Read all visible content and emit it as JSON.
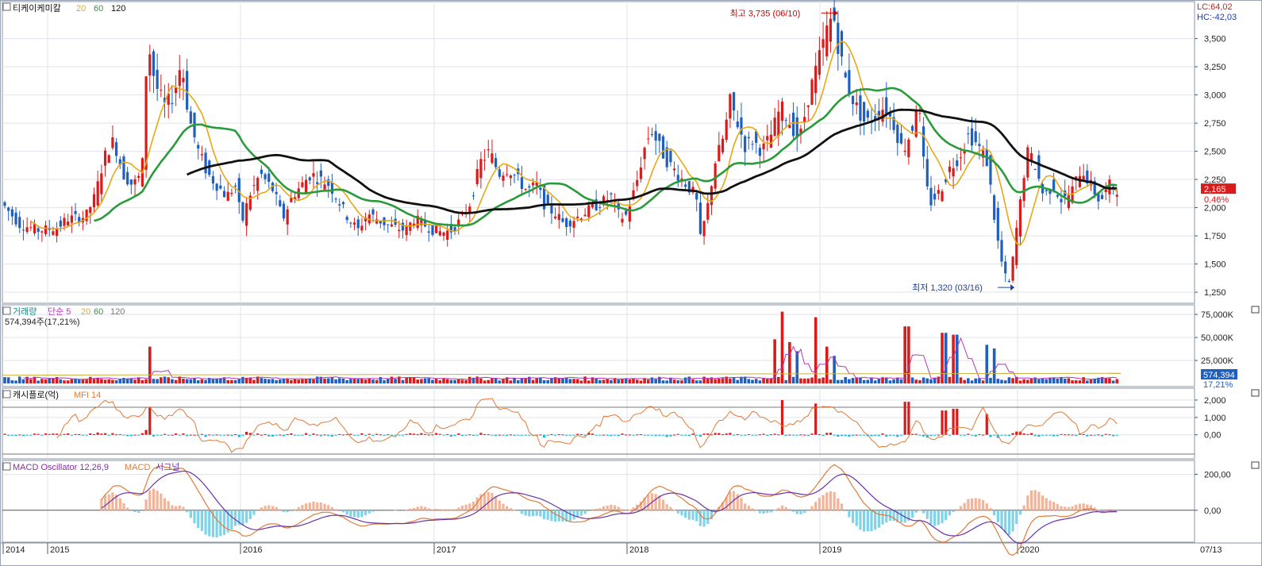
{
  "stock_name": "티케이케미칼",
  "price_ma_periods": [
    "20",
    "60",
    "120"
  ],
  "colors": {
    "up": "#d81b1b",
    "down": "#1f5fbf",
    "ma20": "#e6a817",
    "ma60": "#2b9a3a",
    "ma120": "#111111",
    "grid": "#dfe3ea",
    "mfi": "#e07b39",
    "macd": "#e07b39",
    "signal": "#6a33a8",
    "osc_pos": "#f4b397",
    "osc_neg": "#7fd3e8",
    "cash_pos": "#d81b1b",
    "cash_neg": "#22b6d8"
  },
  "top_right": {
    "lc": "LC:64,02",
    "hc": "HC:-42,03"
  },
  "price_high_label": "최고 3,735 (06/10)",
  "price_low_label": "최저 1,320 (03/16)",
  "last_price_tag": "2,165",
  "last_change_tag": "0.46%",
  "volume_title": {
    "name": "거래량",
    "ma_type": "단순 5",
    "p20": "20",
    "p60": "60",
    "p120": "120"
  },
  "volume_info": "574,394주(17,21%)",
  "volume_tag": "574,394",
  "volume_pct_tag": "17,21%",
  "cash_title": {
    "name": "캐시플로(억)",
    "mfi": "MFI 14"
  },
  "macd_title": {
    "name": "MACD Oscillator 12,26,9",
    "macd": "MACD",
    "signal": "시그널"
  },
  "end_date_label": "07/13",
  "chart_data": [
    {
      "type": "candlestick",
      "title": "티케이케미칼",
      "x_labels": [
        "2014",
        "2015",
        "2016",
        "2017",
        "2018",
        "2019",
        "2020"
      ],
      "y_ticks": [
        1250,
        1500,
        1750,
        2000,
        2250,
        2500,
        2750,
        3000,
        3250,
        3500
      ],
      "y_tick_labels": [
        "1,250",
        "1,500",
        "1,750",
        "2,000",
        "2,250",
        "2,500",
        "2,750",
        "3,000",
        "3,250",
        "3,500"
      ],
      "ylim": [
        1180,
        3800
      ],
      "close_path": [
        {
          "t": 2014.0,
          "v": 2050
        },
        {
          "t": 2014.1,
          "v": 1850
        },
        {
          "t": 2014.2,
          "v": 1800
        },
        {
          "t": 2014.3,
          "v": 1820
        },
        {
          "t": 2014.35,
          "v": 1900
        },
        {
          "t": 2014.45,
          "v": 1920
        },
        {
          "t": 2014.5,
          "v": 2100
        },
        {
          "t": 2014.55,
          "v": 2450
        },
        {
          "t": 2014.6,
          "v": 2600
        },
        {
          "t": 2014.65,
          "v": 2300
        },
        {
          "t": 2014.7,
          "v": 2200
        },
        {
          "t": 2014.75,
          "v": 2300
        },
        {
          "t": 2014.78,
          "v": 3500
        },
        {
          "t": 2014.82,
          "v": 3100
        },
        {
          "t": 2014.87,
          "v": 2900
        },
        {
          "t": 2014.92,
          "v": 3000
        },
        {
          "t": 2014.96,
          "v": 3300
        },
        {
          "t": 2015.0,
          "v": 2800
        },
        {
          "t": 2015.05,
          "v": 2500
        },
        {
          "t": 2015.1,
          "v": 2300
        },
        {
          "t": 2015.15,
          "v": 2200
        },
        {
          "t": 2015.2,
          "v": 2100
        },
        {
          "t": 2015.25,
          "v": 2200
        },
        {
          "t": 2015.28,
          "v": 1850
        },
        {
          "t": 2015.32,
          "v": 2100
        },
        {
          "t": 2015.38,
          "v": 2300
        },
        {
          "t": 2015.45,
          "v": 2150
        },
        {
          "t": 2015.5,
          "v": 1900
        },
        {
          "t": 2015.55,
          "v": 2100
        },
        {
          "t": 2015.6,
          "v": 2200
        },
        {
          "t": 2015.65,
          "v": 2300
        },
        {
          "t": 2015.7,
          "v": 2250
        },
        {
          "t": 2015.75,
          "v": 2200
        },
        {
          "t": 2015.8,
          "v": 2050
        },
        {
          "t": 2015.85,
          "v": 1900
        },
        {
          "t": 2015.9,
          "v": 1800
        },
        {
          "t": 2015.95,
          "v": 1950
        },
        {
          "t": 2016.0,
          "v": 1900
        },
        {
          "t": 2016.05,
          "v": 1850
        },
        {
          "t": 2016.1,
          "v": 1820
        },
        {
          "t": 2016.15,
          "v": 1800
        },
        {
          "t": 2016.2,
          "v": 1900
        },
        {
          "t": 2016.25,
          "v": 1850
        },
        {
          "t": 2016.3,
          "v": 1800
        },
        {
          "t": 2016.35,
          "v": 1780
        },
        {
          "t": 2016.4,
          "v": 1800
        },
        {
          "t": 2016.45,
          "v": 1900
        },
        {
          "t": 2016.5,
          "v": 2050
        },
        {
          "t": 2016.55,
          "v": 2400
        },
        {
          "t": 2016.6,
          "v": 2500
        },
        {
          "t": 2016.65,
          "v": 2300
        },
        {
          "t": 2016.7,
          "v": 2350
        },
        {
          "t": 2016.75,
          "v": 2250
        },
        {
          "t": 2016.8,
          "v": 2150
        },
        {
          "t": 2016.85,
          "v": 2200
        },
        {
          "t": 2016.9,
          "v": 2000
        },
        {
          "t": 2016.95,
          "v": 1950
        },
        {
          "t": 2017.0,
          "v": 1850
        },
        {
          "t": 2017.05,
          "v": 1900
        },
        {
          "t": 2017.1,
          "v": 1950
        },
        {
          "t": 2017.15,
          "v": 2000
        },
        {
          "t": 2017.2,
          "v": 2050
        },
        {
          "t": 2017.25,
          "v": 2100
        },
        {
          "t": 2017.28,
          "v": 1950
        },
        {
          "t": 2017.32,
          "v": 1900
        },
        {
          "t": 2017.38,
          "v": 2200
        },
        {
          "t": 2017.42,
          "v": 2500
        },
        {
          "t": 2017.46,
          "v": 2700
        },
        {
          "t": 2017.5,
          "v": 2550
        },
        {
          "t": 2017.55,
          "v": 2400
        },
        {
          "t": 2017.6,
          "v": 2300
        },
        {
          "t": 2017.65,
          "v": 2200
        },
        {
          "t": 2017.7,
          "v": 2100
        },
        {
          "t": 2017.72,
          "v": 1700
        },
        {
          "t": 2017.76,
          "v": 2000
        },
        {
          "t": 2017.8,
          "v": 2400
        },
        {
          "t": 2017.85,
          "v": 2650
        },
        {
          "t": 2017.88,
          "v": 2950
        },
        {
          "t": 2017.92,
          "v": 2750
        },
        {
          "t": 2017.96,
          "v": 2550
        },
        {
          "t": 2018.0,
          "v": 2600
        },
        {
          "t": 2018.05,
          "v": 2500
        },
        {
          "t": 2018.1,
          "v": 2650
        },
        {
          "t": 2018.15,
          "v": 2900
        },
        {
          "t": 2018.2,
          "v": 2750
        },
        {
          "t": 2018.25,
          "v": 2600
        },
        {
          "t": 2018.3,
          "v": 3000
        },
        {
          "t": 2018.35,
          "v": 3300
        },
        {
          "t": 2018.4,
          "v": 3600
        },
        {
          "t": 2018.43,
          "v": 3720
        },
        {
          "t": 2018.46,
          "v": 3400
        },
        {
          "t": 2018.5,
          "v": 3100
        },
        {
          "t": 2018.55,
          "v": 2900
        },
        {
          "t": 2018.6,
          "v": 2750
        },
        {
          "t": 2018.65,
          "v": 2800
        },
        {
          "t": 2018.7,
          "v": 2900
        },
        {
          "t": 2018.75,
          "v": 2750
        },
        {
          "t": 2018.8,
          "v": 2500
        },
        {
          "t": 2018.85,
          "v": 2700
        },
        {
          "t": 2018.88,
          "v": 3000
        },
        {
          "t": 2018.92,
          "v": 2200
        },
        {
          "t": 2018.95,
          "v": 2050
        },
        {
          "t": 2019.0,
          "v": 2150
        },
        {
          "t": 2019.05,
          "v": 2350
        },
        {
          "t": 2019.1,
          "v": 2450
        },
        {
          "t": 2019.15,
          "v": 2650
        },
        {
          "t": 2019.2,
          "v": 2550
        },
        {
          "t": 2019.25,
          "v": 2400
        },
        {
          "t": 2019.28,
          "v": 2000
        },
        {
          "t": 2019.31,
          "v": 1650
        },
        {
          "t": 2019.34,
          "v": 1400
        },
        {
          "t": 2019.37,
          "v": 1320
        },
        {
          "t": 2019.4,
          "v": 1750
        },
        {
          "t": 2019.43,
          "v": 2100
        },
        {
          "t": 2019.46,
          "v": 2500
        },
        {
          "t": 2019.5,
          "v": 2400
        },
        {
          "t": 2019.55,
          "v": 2100
        },
        {
          "t": 2019.6,
          "v": 2200
        },
        {
          "t": 2019.65,
          "v": 2050
        },
        {
          "t": 2019.7,
          "v": 2150
        },
        {
          "t": 2019.75,
          "v": 2350
        },
        {
          "t": 2019.8,
          "v": 2200
        },
        {
          "t": 2019.85,
          "v": 2050
        },
        {
          "t": 2019.9,
          "v": 2200
        },
        {
          "t": 2019.94,
          "v": 2165
        }
      ]
    },
    {
      "type": "bar",
      "title": "거래량",
      "y_ticks": [
        25000,
        50000,
        75000
      ],
      "y_tick_labels": [
        "25,000K",
        "50,000K",
        "75,000K"
      ],
      "ylim": [
        0,
        82000
      ],
      "spikes": [
        {
          "t": 2014.78,
          "v": 40000
        },
        {
          "t": 2018.1,
          "v": 48000
        },
        {
          "t": 2018.14,
          "v": 78000
        },
        {
          "t": 2018.18,
          "v": 45000
        },
        {
          "t": 2018.22,
          "v": 35000
        },
        {
          "t": 2018.32,
          "v": 72000
        },
        {
          "t": 2018.38,
          "v": 40000
        },
        {
          "t": 2018.42,
          "v": 30000
        },
        {
          "t": 2018.8,
          "v": 62000
        },
        {
          "t": 2019.0,
          "v": 55000
        },
        {
          "t": 2019.06,
          "v": 53000
        },
        {
          "t": 2019.22,
          "v": 42000
        },
        {
          "t": 2019.26,
          "v": 38000
        }
      ],
      "baseline": 5000
    },
    {
      "type": "bar",
      "title": "캐시플로(억)",
      "y_ticks": [
        0,
        1000,
        2000
      ],
      "y_tick_labels": [
        "0,00",
        "1,000",
        "2,000"
      ],
      "ylim": [
        -1200,
        2500
      ],
      "spikes": [
        {
          "t": 2014.78,
          "v": 1600
        },
        {
          "t": 2018.14,
          "v": 2000
        },
        {
          "t": 2018.32,
          "v": 1800
        },
        {
          "t": 2018.8,
          "v": 1900
        },
        {
          "t": 2019.0,
          "v": 1400
        },
        {
          "t": 2019.06,
          "v": 1500
        },
        {
          "t": 2019.22,
          "v": 1200
        }
      ]
    },
    {
      "type": "line",
      "title": "MACD Oscillator 12,26,9",
      "y_ticks": [
        0,
        200
      ],
      "y_tick_labels": [
        "0,00",
        "200,00"
      ],
      "ylim": [
        -160,
        260
      ]
    }
  ]
}
